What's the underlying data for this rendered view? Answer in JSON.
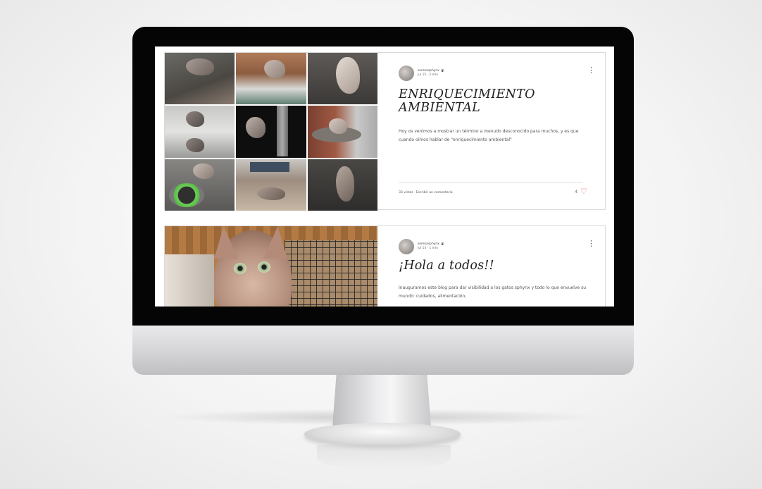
{
  "posts": [
    {
      "author": "serenasphynx",
      "date": "jul 15 · 2 min",
      "title": "ENRIQUECIMIENTO AMBIENTAL",
      "excerpt": "Hoy os venimos a mostrar un término a menudo desconocido para muchos, y es que cuando oímos hablar de \"enriquecimiento ambiental\"",
      "views": "33 vistas",
      "comment_cta": "Escribir un comentario",
      "likes": "4"
    },
    {
      "author": "serenasphynx",
      "date": "jul 13 · 1 min",
      "title": "¡Hola a todos!!",
      "excerpt": "Inauguramos este blog para dar visibilidad a los gatos sphynx y todo lo que envuelve su mundo: cuidados, alimentación,"
    }
  ],
  "icons": {
    "crown": "crown-icon",
    "menu": "more-options-icon",
    "heart": "heart-icon"
  },
  "colors": {
    "accent_heart": "#e0504a",
    "bezel": "#050505"
  }
}
